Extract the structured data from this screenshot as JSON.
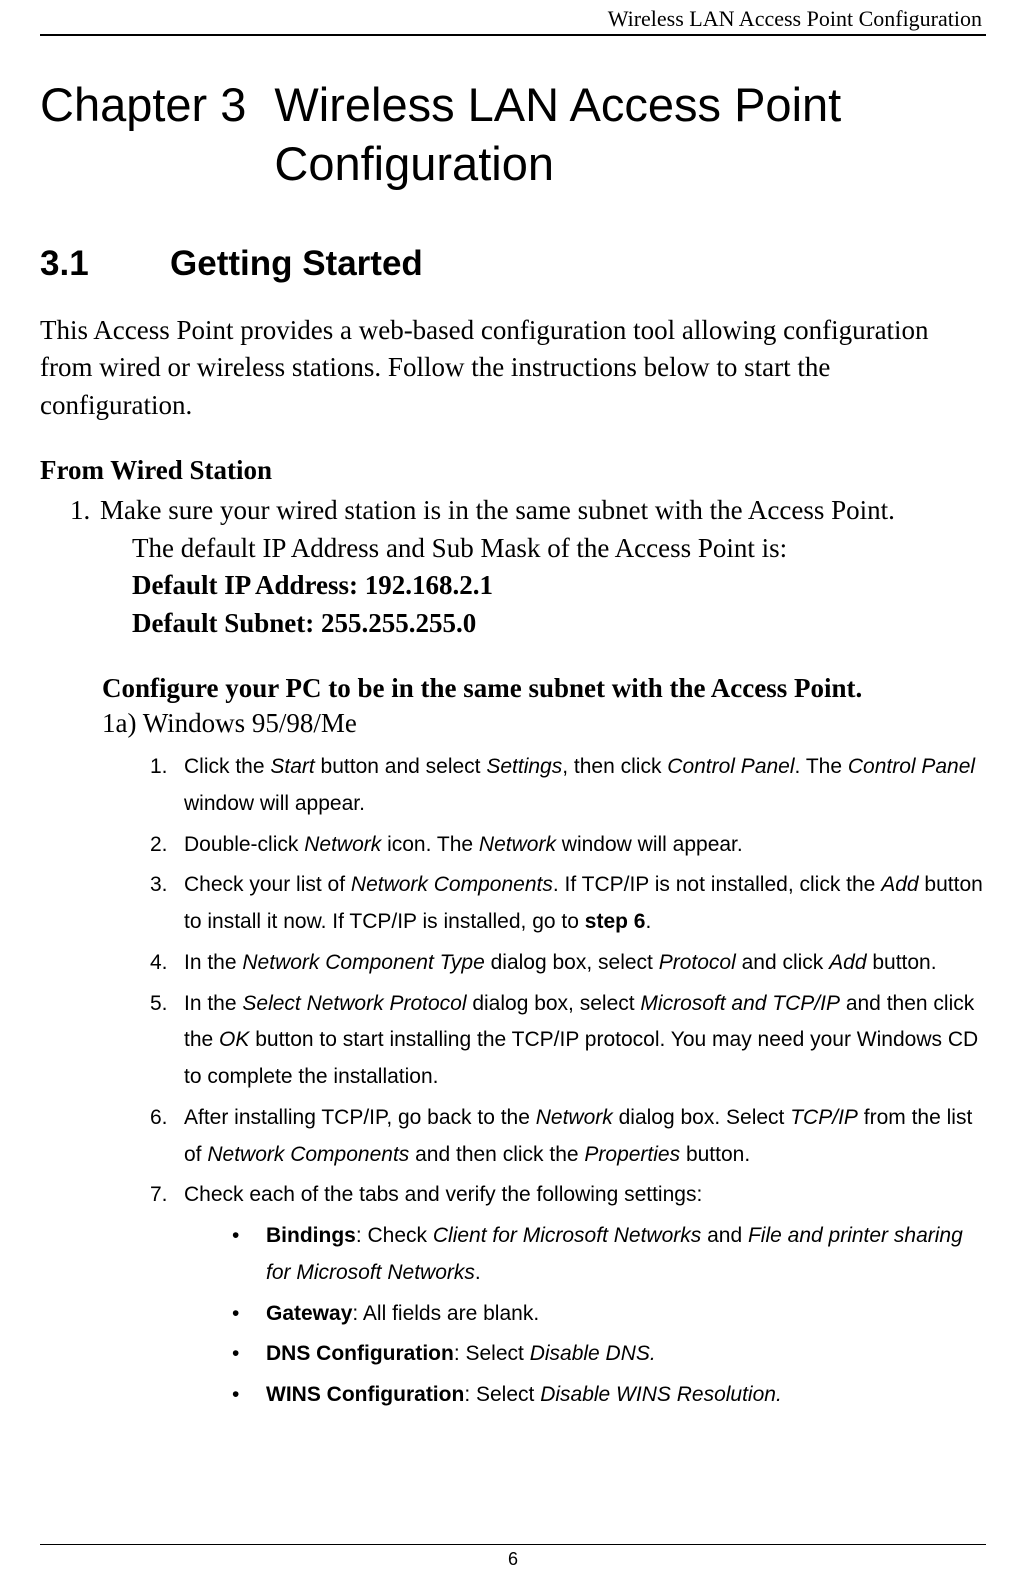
{
  "header": {
    "running": "Wireless LAN Access Point Configuration"
  },
  "chapter": {
    "label": "Chapter 3",
    "title": "Wireless LAN Access Point Configuration"
  },
  "section": {
    "number": "3.1",
    "title": "Getting Started"
  },
  "intro": "This Access Point provides a web-based configuration tool allowing configuration from wired or wireless stations. Follow the instructions below to start the configuration.",
  "wired": {
    "heading": "From Wired Station",
    "step1_num": "1.",
    "step1_line1": "Make sure your wired station is in the same subnet with the Access Point.",
    "step1_line2": "The default IP Address and Sub Mask of the Access Point is:",
    "default_ip": "Default IP Address: 192.168.2.1",
    "default_subnet": "Default Subnet: 255.255.255.0",
    "config_head": "Configure your PC to be in the same subnet with the Access Point.",
    "os_head": "1a) Windows 95/98/Me"
  },
  "steps": {
    "s1": {
      "num": "1.",
      "pre": "Click the ",
      "i1": "Start",
      "mid1": " button and select ",
      "i2": "Settings",
      "mid2": ", then click ",
      "i3": "Control Panel",
      "mid3": ". The ",
      "i4": "Control Panel",
      "tail": " window will appear."
    },
    "s2": {
      "num": "2.",
      "pre": "Double-click ",
      "i1": "Network",
      "mid": " icon. The ",
      "i2": "Network",
      "tail": " window will appear."
    },
    "s3": {
      "num": "3.",
      "pre": "Check your list of ",
      "i1": "Network Components",
      "mid": ". If TCP/IP is not installed, click the ",
      "i2": "Add",
      "mid2": " button to install it now. If TCP/IP is installed, go to ",
      "b1": "step 6",
      "tail": "."
    },
    "s4": {
      "num": "4.",
      "pre": "In the ",
      "i1": "Network Component Type",
      "mid": " dialog box, select ",
      "i2": "Protocol",
      "mid2": " and click ",
      "i3": "Add",
      "tail": " button."
    },
    "s5": {
      "num": "5.",
      "pre": "In the ",
      "i1": "Select Network Protocol",
      "mid": " dialog box, select ",
      "i2": "Microsoft and TCP/IP",
      "mid2": " and then click the ",
      "i3": "OK",
      "tail": " button to start installing the TCP/IP protocol. You may need your Windows CD to complete the installation."
    },
    "s6": {
      "num": "6.",
      "pre": "After installing TCP/IP, go back to the ",
      "i1": "Network",
      "mid": " dialog box. Select ",
      "i2": "TCP/IP",
      "mid2": " from the list of ",
      "i3": "Network Components",
      "mid3": " and then click the ",
      "i4": "Properties",
      "tail": " button."
    },
    "s7": {
      "num": "7.",
      "text": "Check each of the tabs and verify the following settings:"
    }
  },
  "bullets": {
    "b1": {
      "dot": "•",
      "label": "Bindings",
      "sep": ": Check ",
      "i1": "Client for Microsoft Networks",
      "mid": " and ",
      "i2": "File and printer sharing for Microsoft Networks",
      "tail": "."
    },
    "b2": {
      "dot": "•",
      "label": "Gateway",
      "tail": ": All fields are blank."
    },
    "b3": {
      "dot": "•",
      "label": "DNS Configuration",
      "sep": ": Select ",
      "i1": "Disable DNS."
    },
    "b4": {
      "dot": "•",
      "label": "WINS Configuration",
      "sep": ": Select ",
      "i1": "Disable WINS Resolution."
    }
  },
  "footer": {
    "page": "6"
  }
}
